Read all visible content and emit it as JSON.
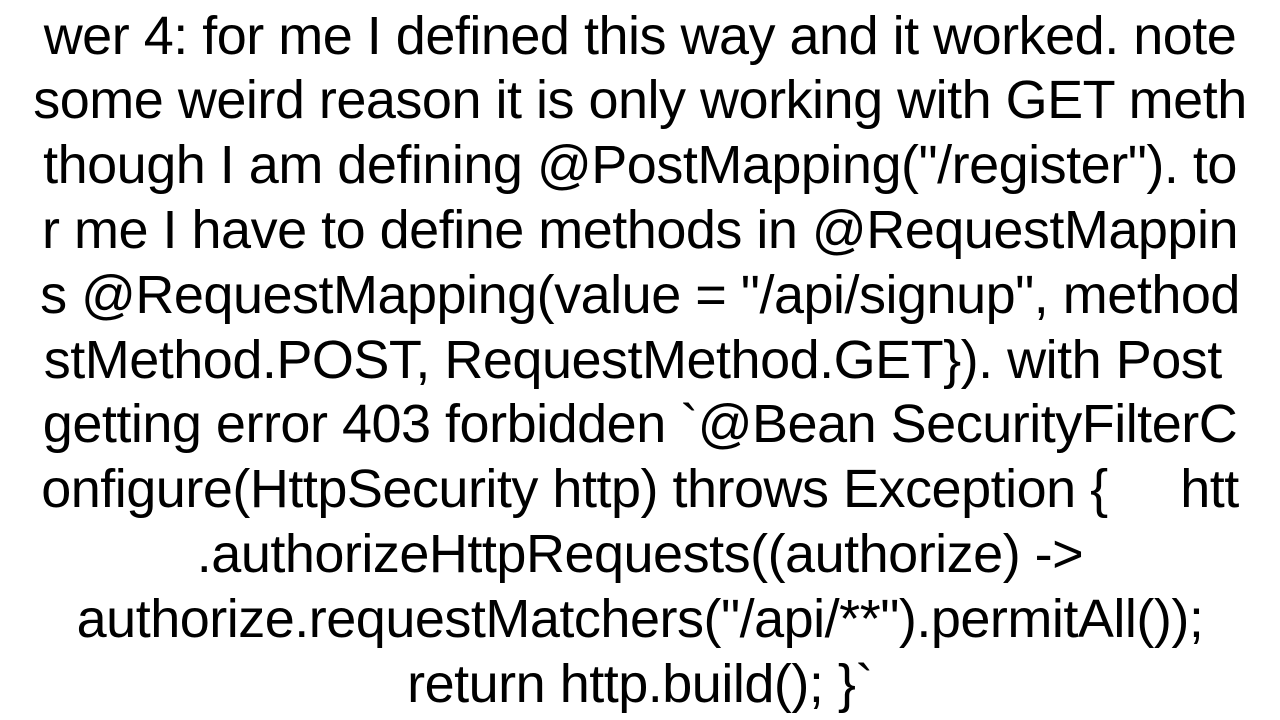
{
  "document": {
    "body_text": "wer 4: for me I defined this way and it worked. note\nsome weird reason it is only working with GET meth\nthough I am defining @PostMapping(\"/register\"). to\nr me I have to define methods in @RequestMappin\ns @RequestMapping(value = \"/api/signup\", method\nstMethod.POST, RequestMethod.GET}). with Post \ngetting error 403 forbidden `@Bean SecurityFilterC\nonfigure(HttpSecurity http) throws Exception {     htt\n.authorizeHttpRequests((authorize) ->\nauthorize.requestMatchers(\"/api/**\").permitAll());\nreturn http.build(); }`"
  }
}
